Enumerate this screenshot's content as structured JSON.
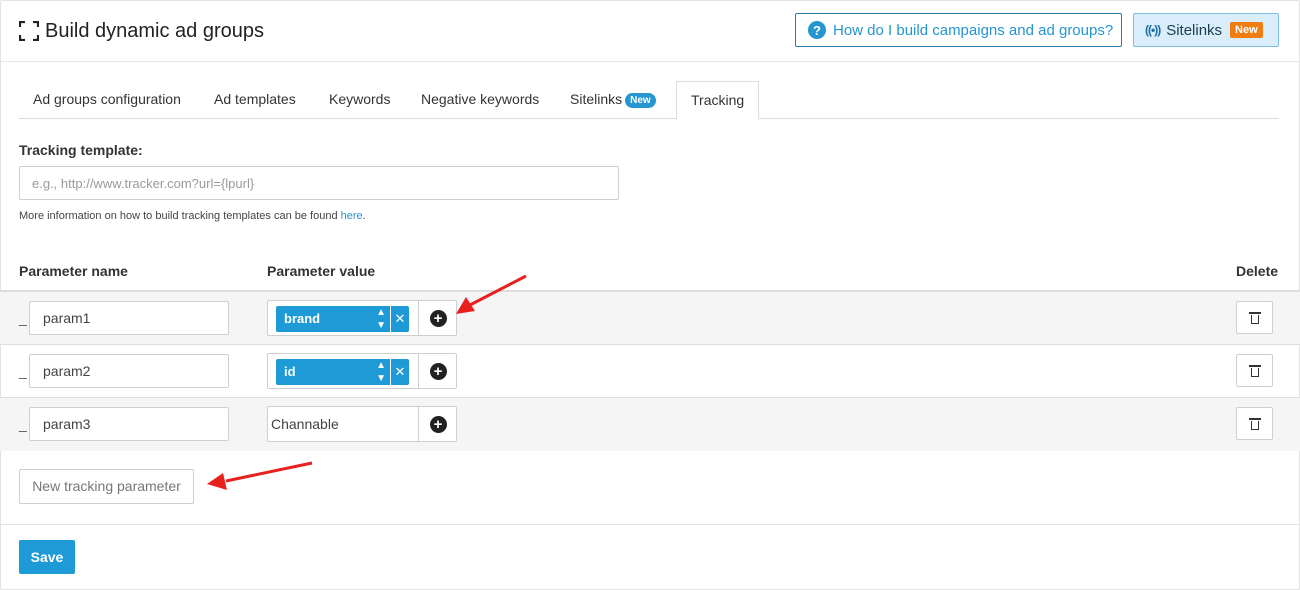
{
  "header": {
    "title": "Build dynamic ad groups",
    "help_link": "How do I build campaigns and ad groups?",
    "sitelinks_label": "Sitelinks",
    "sitelinks_badge": "New"
  },
  "tabs": [
    {
      "label": "Ad groups configuration",
      "badge": ""
    },
    {
      "label": "Ad templates",
      "badge": ""
    },
    {
      "label": "Keywords",
      "badge": ""
    },
    {
      "label": "Negative keywords",
      "badge": ""
    },
    {
      "label": "Sitelinks",
      "badge": "New"
    },
    {
      "label": "Tracking",
      "badge": "",
      "active": true
    }
  ],
  "tracking": {
    "label": "Tracking template:",
    "placeholder": "e.g., http://www.tracker.com?url={lpurl}",
    "value": "",
    "info_text": "More information on how to build tracking templates can be found ",
    "info_link": "here",
    "info_end": "."
  },
  "table": {
    "headers": {
      "name": "Parameter name",
      "value": "Parameter value",
      "delete": "Delete"
    },
    "rows": [
      {
        "dash": "_",
        "name": "param1",
        "value": "brand",
        "value_type": "field"
      },
      {
        "dash": "_",
        "name": "param2",
        "value": "id",
        "value_type": "field"
      },
      {
        "dash": "_",
        "name": "param3",
        "value": "Channable",
        "value_type": "text"
      }
    ]
  },
  "actions": {
    "new_parameter": "New tracking parameter",
    "save": "Save"
  },
  "colors": {
    "accent_blue": "#1e9ad6",
    "badge_orange": "#f07d14",
    "annotation_arrow": "#e8201e"
  }
}
